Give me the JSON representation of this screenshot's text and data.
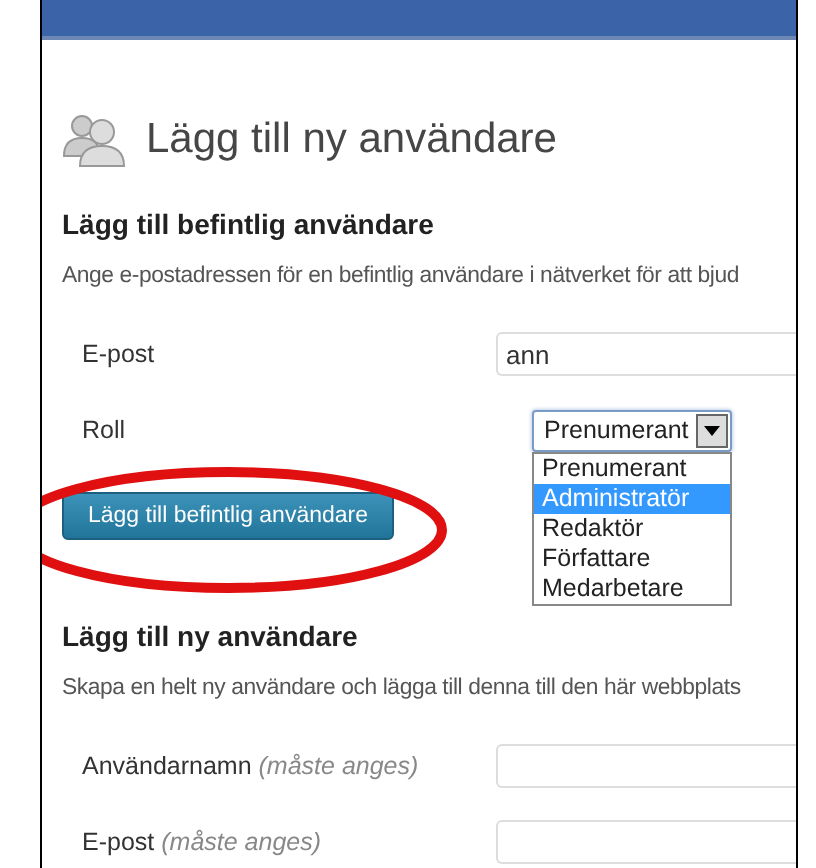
{
  "page": {
    "title": "Lägg till ny användare"
  },
  "existing_user": {
    "heading": "Lägg till befintlig användare",
    "description": "Ange e-postadressen för en befintlig användare i nätverket för att bjud",
    "email": {
      "label": "E-post",
      "value": "ann"
    },
    "role": {
      "label": "Roll",
      "value": "Prenumerant",
      "expanded": true,
      "options": [
        {
          "label": "Prenumerant",
          "highlighted": false
        },
        {
          "label": "Administratör",
          "highlighted": true
        },
        {
          "label": "Redaktör",
          "highlighted": false
        },
        {
          "label": "Författare",
          "highlighted": false
        },
        {
          "label": "Medarbetare",
          "highlighted": false
        }
      ]
    },
    "submit": "Lägg till befintlig användare"
  },
  "new_user": {
    "heading": "Lägg till ny användare",
    "description": "Skapa en helt ny användare och lägga till denna till den här webbplats",
    "fields": [
      {
        "label": "Användarnamn",
        "hint": "(måste anges)"
      },
      {
        "label": "E-post",
        "hint": "(måste anges)"
      }
    ]
  }
}
